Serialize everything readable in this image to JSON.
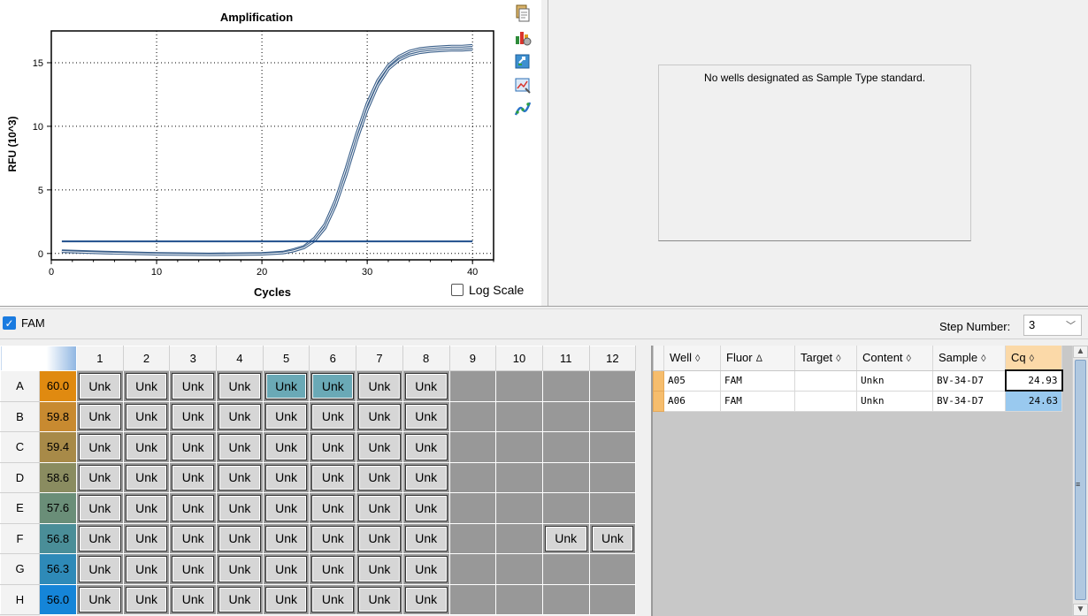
{
  "chart": {
    "title": "Amplification",
    "xlabel": "Cycles",
    "ylabel": "RFU (10^3)",
    "log_scale_label": "Log Scale",
    "log_scale_checked": false
  },
  "chart_data": {
    "type": "line",
    "title": "Amplification",
    "xlabel": "Cycles",
    "ylabel": "RFU (10^3)",
    "xlim": [
      0,
      42
    ],
    "ylim": [
      -0.5,
      17.5
    ],
    "xticks": [
      0,
      10,
      20,
      30,
      40
    ],
    "yticks": [
      0,
      5,
      10,
      15
    ],
    "grid": "dotted",
    "series": [
      {
        "x": [
          1,
          5,
          10,
          15,
          20,
          22,
          23,
          24,
          25,
          26,
          27,
          28,
          29,
          30,
          31,
          32,
          33,
          34,
          35,
          36,
          37,
          38,
          39,
          40
        ],
        "y": [
          0.2,
          0.1,
          0.0,
          -0.05,
          0.0,
          0.1,
          0.3,
          0.55,
          1.2,
          2.3,
          4.2,
          6.7,
          9.4,
          11.8,
          13.6,
          14.8,
          15.5,
          15.9,
          16.1,
          16.2,
          16.25,
          16.3,
          16.3,
          16.35
        ]
      },
      {
        "x": [
          1,
          5,
          10,
          15,
          20,
          22,
          23,
          24,
          25,
          26,
          27,
          28,
          29,
          30,
          31,
          32,
          33,
          34,
          35,
          36,
          37,
          38,
          39,
          40
        ],
        "y": [
          0.15,
          0.05,
          -0.05,
          -0.1,
          -0.05,
          0.05,
          0.2,
          0.45,
          1.0,
          2.0,
          3.8,
          6.2,
          8.9,
          11.3,
          13.2,
          14.5,
          15.2,
          15.6,
          15.8,
          15.9,
          15.95,
          16.0,
          16.0,
          16.05
        ]
      },
      {
        "x": [
          1,
          40
        ],
        "y": [
          0.95,
          0.95
        ]
      }
    ],
    "colors": {
      "curve": "#3a5f8a",
      "curve_inner": "#ffffff",
      "threshold": "#1f4e8c"
    }
  },
  "toolbar_icons": [
    "copy-icon",
    "chart-settings-icon",
    "export-icon",
    "zoom-icon",
    "curve-fit-icon"
  ],
  "standard_curve": {
    "message": "No wells designated as Sample Type standard."
  },
  "fluor_toggle": {
    "label": "FAM",
    "checked": true
  },
  "step": {
    "label": "Step Number:",
    "value": "3"
  },
  "plate": {
    "columns": [
      "1",
      "2",
      "3",
      "4",
      "5",
      "6",
      "7",
      "8",
      "9",
      "10",
      "11",
      "12"
    ],
    "rows": [
      {
        "label": "A",
        "temp": "60.0",
        "temp_color": "#e08a10",
        "wells": [
          "Unk",
          "Unk",
          "Unk",
          "Unk",
          "Unk*",
          "Unk*",
          "Unk",
          "Unk",
          "",
          "",
          "",
          ""
        ]
      },
      {
        "label": "B",
        "temp": "59.8",
        "temp_color": "#c88a30",
        "wells": [
          "Unk",
          "Unk",
          "Unk",
          "Unk",
          "Unk",
          "Unk",
          "Unk",
          "Unk",
          "",
          "",
          "",
          ""
        ]
      },
      {
        "label": "C",
        "temp": "59.4",
        "temp_color": "#a88a48",
        "wells": [
          "Unk",
          "Unk",
          "Unk",
          "Unk",
          "Unk",
          "Unk",
          "Unk",
          "Unk",
          "",
          "",
          "",
          ""
        ]
      },
      {
        "label": "D",
        "temp": "58.6",
        "temp_color": "#8a8c60",
        "wells": [
          "Unk",
          "Unk",
          "Unk",
          "Unk",
          "Unk",
          "Unk",
          "Unk",
          "Unk",
          "",
          "",
          "",
          ""
        ]
      },
      {
        "label": "E",
        "temp": "57.6",
        "temp_color": "#6a8e78",
        "wells": [
          "Unk",
          "Unk",
          "Unk",
          "Unk",
          "Unk",
          "Unk",
          "Unk",
          "Unk",
          "",
          "",
          "",
          ""
        ]
      },
      {
        "label": "F",
        "temp": "56.8",
        "temp_color": "#4a8e98",
        "wells": [
          "Unk",
          "Unk",
          "Unk",
          "Unk",
          "Unk",
          "Unk",
          "Unk",
          "Unk",
          "",
          "",
          "Unk",
          "Unk"
        ]
      },
      {
        "label": "G",
        "temp": "56.3",
        "temp_color": "#2e8ab8",
        "wells": [
          "Unk",
          "Unk",
          "Unk",
          "Unk",
          "Unk",
          "Unk",
          "Unk",
          "Unk",
          "",
          "",
          "",
          ""
        ]
      },
      {
        "label": "H",
        "temp": "56.0",
        "temp_color": "#1585d8",
        "wells": [
          "Unk",
          "Unk",
          "Unk",
          "Unk",
          "Unk",
          "Unk",
          "Unk",
          "Unk",
          "",
          "",
          "",
          ""
        ]
      }
    ]
  },
  "results": {
    "headers": [
      {
        "label": "Well",
        "sort": "◊"
      },
      {
        "label": "Fluor",
        "sort": "Δ"
      },
      {
        "label": "Target",
        "sort": "◊"
      },
      {
        "label": "Content",
        "sort": "◊"
      },
      {
        "label": "Sample",
        "sort": "◊"
      },
      {
        "label": "Cq",
        "sort": "◊"
      }
    ],
    "rows": [
      {
        "well": "A05",
        "fluor": "FAM",
        "target": "",
        "content": "Unkn",
        "sample": "BV-34-D7",
        "cq": "24.93"
      },
      {
        "well": "A06",
        "fluor": "FAM",
        "target": "",
        "content": "Unkn",
        "sample": "BV-34-D7",
        "cq": "24.63"
      }
    ]
  }
}
